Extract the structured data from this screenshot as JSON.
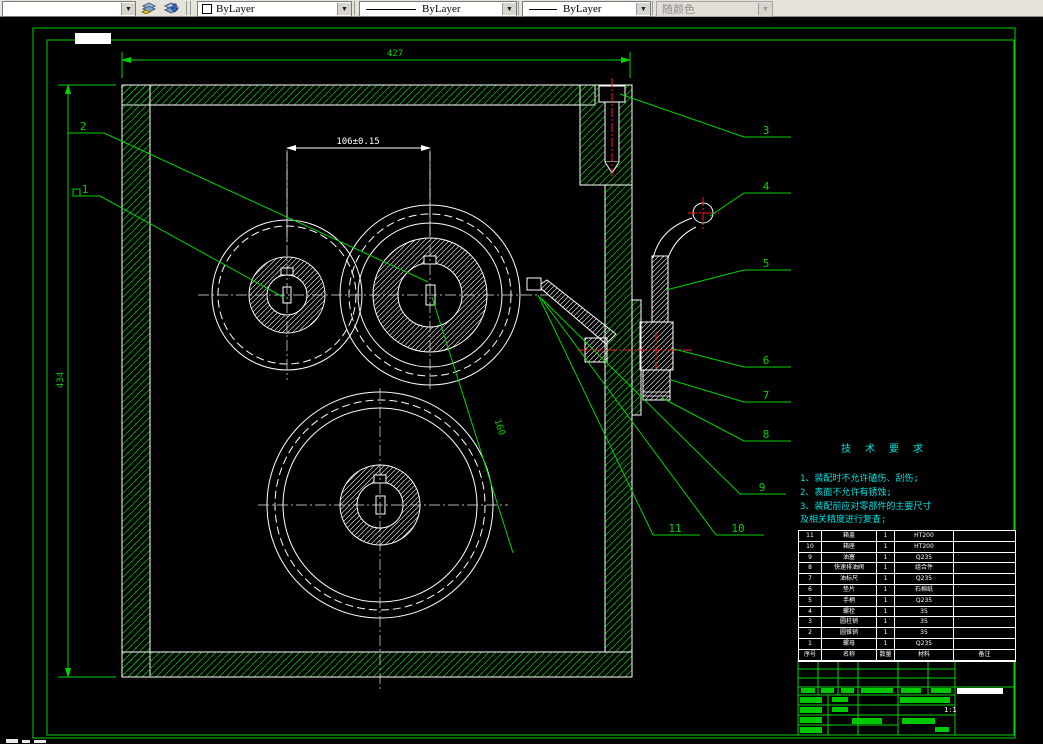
{
  "toolbar": {
    "layer_combo": {
      "value": ""
    },
    "color_combo": {
      "value": "ByLayer"
    },
    "linetype_combo": {
      "value": "ByLayer"
    },
    "lineweight_combo": {
      "value": "ByLayer"
    },
    "plotstyle_combo": {
      "value": "随颜色"
    }
  },
  "drawing": {
    "dimensions": {
      "top_width": "427",
      "left_height": "434",
      "center_distance": "106±0.15",
      "slant_label": "160"
    },
    "callouts": [
      "1",
      "2",
      "3",
      "4",
      "5",
      "6",
      "7",
      "8",
      "9",
      "10",
      "11"
    ],
    "tech_requirements": {
      "title": "技 术 要 求",
      "lines": [
        "1、装配时不允许磕伤、刮伤;",
        "2、表面不允许有锈蚀;",
        "3、装配前应对零部件的主要尺寸",
        "及相关精度进行复查;"
      ]
    }
  },
  "parts_list": {
    "header": {
      "no": "序号",
      "name": "名称",
      "qty": "数量",
      "material": "材料",
      "remark": "备注"
    },
    "rows": [
      {
        "no": "11",
        "name": "箱盖",
        "qty": "1",
        "material": "HT200",
        "remark": ""
      },
      {
        "no": "10",
        "name": "箱座",
        "qty": "1",
        "material": "HT200",
        "remark": ""
      },
      {
        "no": "9",
        "name": "油塞",
        "qty": "1",
        "material": "Q235",
        "remark": ""
      },
      {
        "no": "8",
        "name": "快速排油阀",
        "qty": "1",
        "material": "组合件",
        "remark": ""
      },
      {
        "no": "7",
        "name": "油标尺",
        "qty": "1",
        "material": "Q235",
        "remark": ""
      },
      {
        "no": "6",
        "name": "垫片",
        "qty": "1",
        "material": "石棉纸",
        "remark": ""
      },
      {
        "no": "5",
        "name": "手柄",
        "qty": "1",
        "material": "Q235",
        "remark": ""
      },
      {
        "no": "4",
        "name": "螺栓",
        "qty": "1",
        "material": "35",
        "remark": ""
      },
      {
        "no": "3",
        "name": "圆柱销",
        "qty": "1",
        "material": "35",
        "remark": ""
      },
      {
        "no": "2",
        "name": "圆锥销",
        "qty": "1",
        "material": "35",
        "remark": ""
      },
      {
        "no": "1",
        "name": "螺母",
        "qty": "1",
        "material": "Q235",
        "remark": ""
      }
    ]
  },
  "title_block": {
    "scale": "1:1"
  },
  "colors": {
    "background": "#000000",
    "line_green": "#00d400",
    "hatch_green": "#00b400",
    "annotation_cyan": "#00e0e0",
    "centerline_red": "#ff1a1a",
    "drawing_white": "#ffffff",
    "toolbar_bg": "#e6e3da"
  }
}
